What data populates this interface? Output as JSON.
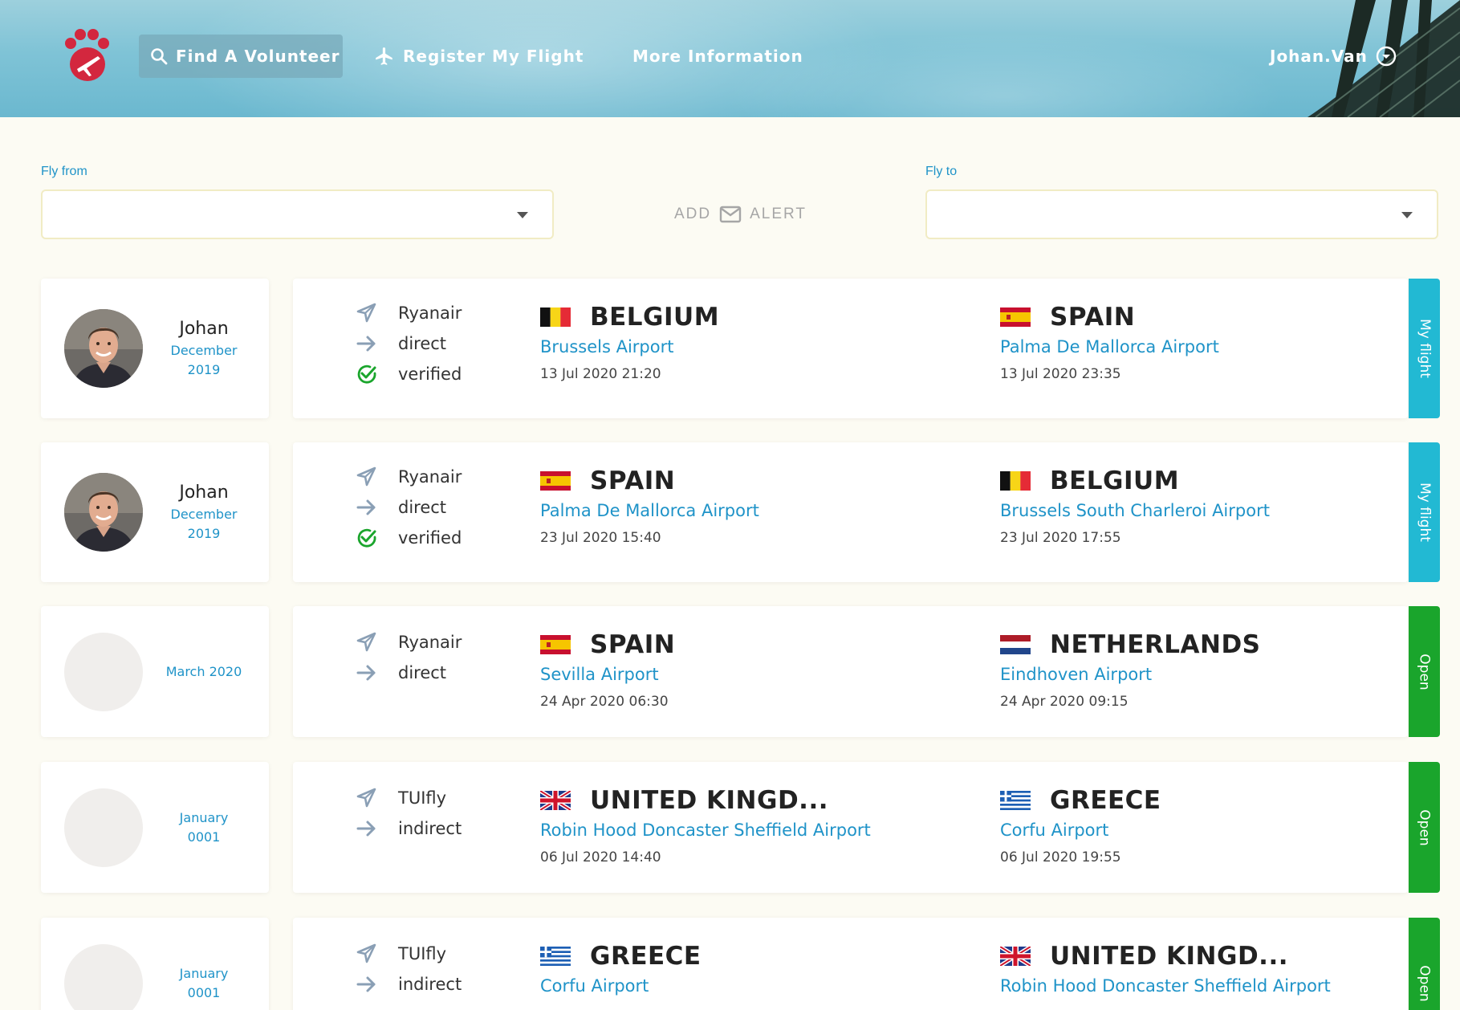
{
  "nav": {
    "find": "Find A Volunteer",
    "register": "Register My Flight",
    "info": "More Information",
    "user": "Johan.Van"
  },
  "filters": {
    "from_label": "Fly from",
    "to_label": "Fly to",
    "add_label": "ADD",
    "alert_label": "ALERT"
  },
  "colors": {
    "accent_blue": "#1f93c8",
    "my_flight": "#22b9d3",
    "open": "#1aa52c",
    "logo": "#d3273e"
  },
  "flights": [
    {
      "user_name": "Johan",
      "since": [
        "December",
        "2019"
      ],
      "has_photo": true,
      "airline": "Ryanair",
      "route": "direct",
      "verified": "verified",
      "from_flag": "be",
      "from_country": "BELGIUM",
      "from_airport": "Brussels Airport",
      "from_time": "13 Jul 2020 21:20",
      "to_flag": "es",
      "to_country": "SPAIN",
      "to_airport": "Palma De Mallorca Airport",
      "to_time": "13 Jul 2020 23:35",
      "status": "My flight",
      "status_type": "my"
    },
    {
      "user_name": "Johan",
      "since": [
        "December",
        "2019"
      ],
      "has_photo": true,
      "airline": "Ryanair",
      "route": "direct",
      "verified": "verified",
      "from_flag": "es",
      "from_country": "SPAIN",
      "from_airport": "Palma De Mallorca Airport",
      "from_time": "23 Jul 2020 15:40",
      "to_flag": "be",
      "to_country": "BELGIUM",
      "to_airport": "Brussels South Charleroi Airport",
      "to_time": "23 Jul 2020 17:55",
      "status": "My flight",
      "status_type": "my"
    },
    {
      "user_name": "",
      "since": [
        "March 2020"
      ],
      "has_photo": false,
      "airline": "Ryanair",
      "route": "direct",
      "verified": "",
      "from_flag": "es",
      "from_country": "SPAIN",
      "from_airport": "Sevilla Airport",
      "from_time": "24 Apr 2020 06:30",
      "to_flag": "nl",
      "to_country": "NETHERLANDS",
      "to_airport": "Eindhoven Airport",
      "to_time": "24 Apr 2020 09:15",
      "status": "Open",
      "status_type": "open"
    },
    {
      "user_name": "",
      "since": [
        "January",
        "0001"
      ],
      "has_photo": false,
      "airline": "TUIfly",
      "route": "indirect",
      "verified": "",
      "from_flag": "gb",
      "from_country": "UNITED KINGD...",
      "from_airport": "Robin Hood Doncaster Sheffield Airport",
      "from_time": "06 Jul 2020 14:40",
      "to_flag": "gr",
      "to_country": "GREECE",
      "to_airport": "Corfu Airport",
      "to_time": "06 Jul 2020 19:55",
      "status": "Open",
      "status_type": "open"
    },
    {
      "user_name": "",
      "since": [
        "January",
        "0001"
      ],
      "has_photo": false,
      "airline": "TUIfly",
      "route": "indirect",
      "verified": "",
      "from_flag": "gr",
      "from_country": "GREECE",
      "from_airport": "Corfu Airport",
      "from_time": "",
      "to_flag": "gb",
      "to_country": "UNITED KINGD...",
      "to_airport": "Robin Hood Doncaster Sheffield Airport",
      "to_time": "",
      "status": "Open",
      "status_type": "open"
    }
  ]
}
